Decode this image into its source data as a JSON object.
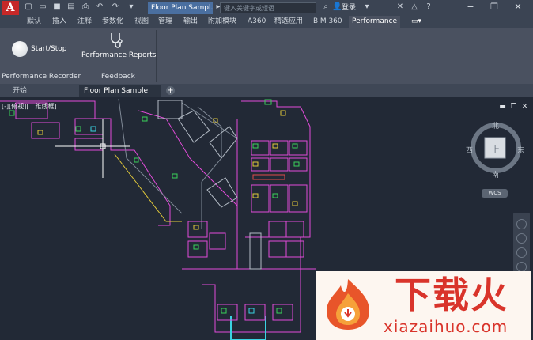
{
  "app": {
    "logo_letter": "A",
    "accent": "#c62828"
  },
  "titlebar": {
    "doc_title": "Floor Plan Sampl...",
    "search_placeholder": "键入关键字或短语",
    "login_label": "登录",
    "quick_access_icons": [
      "new-icon",
      "open-icon",
      "save-icon",
      "saveas-icon",
      "plot-icon",
      "undo-icon",
      "redo-icon",
      "share-icon"
    ]
  },
  "ribbon_tabs": [
    "默认",
    "插入",
    "注释",
    "参数化",
    "视图",
    "管理",
    "输出",
    "附加模块",
    "A360",
    "精选应用",
    "BIM 360",
    "Performance"
  ],
  "ribbon": {
    "start_stop_label": "Start/Stop",
    "performance_reports_label": "Performance Reports",
    "panel_recorder_title": "Performance Recorder",
    "panel_feedback_title": "Feedback"
  },
  "file_tabs": {
    "start_label": "开始",
    "drawing_label": "Floor Plan Sample",
    "add_label": "+"
  },
  "drawing": {
    "viewport_label": "[-][俯视][二维线框]",
    "viewcube": {
      "north": "北",
      "south": "南",
      "east": "东",
      "west": "西",
      "top": "上"
    },
    "wcs_label": "WCS"
  },
  "watermark": {
    "main": "下载火",
    "sub": "xiazaihuo.com"
  }
}
